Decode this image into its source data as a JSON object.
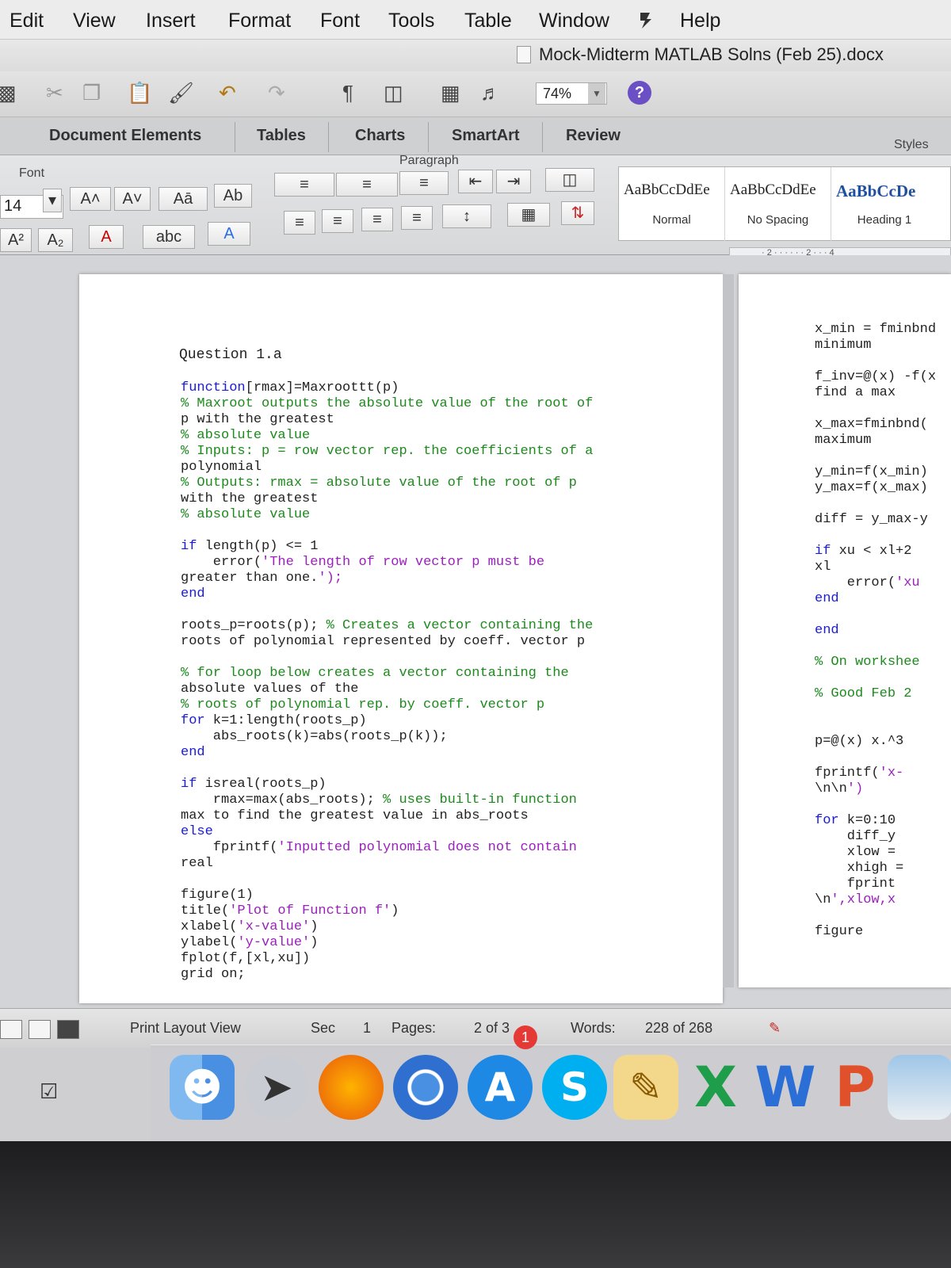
{
  "menu": [
    "Edit",
    "View",
    "Insert",
    "Format",
    "Font",
    "Tools",
    "Table",
    "Window",
    "Help"
  ],
  "title": "Mock-Midterm MATLAB Solns (Feb 25).docx",
  "toolbar": {
    "zoom": "74%",
    "help": "?"
  },
  "ribbon": {
    "tabs": [
      "Document Elements",
      "Tables",
      "Charts",
      "SmartArt",
      "Review"
    ],
    "font_group": "Font",
    "paragraph_group": "Paragraph",
    "styles_group": "Styles",
    "font_size": "14",
    "styles": [
      {
        "sample": "AaBbCcDdEe",
        "name": "Normal"
      },
      {
        "sample": "AaBbCcDdEe",
        "name": "No Spacing"
      },
      {
        "sample": "AaBbCcDe",
        "name": "Heading 1"
      }
    ],
    "ruler": "· 2 · · · · · · 2 · · · 4"
  },
  "document": {
    "question": "Question 1.a",
    "lines": [
      "function[rmax]=Maxroottt(p)",
      "% Maxroot outputs the absolute value of the root of",
      "p with the greatest",
      "% absolute value",
      "% Inputs: p = row vector rep. the coefficients of a",
      "polynomial",
      "% Outputs: rmax = absolute value of the root of p",
      "with the greatest",
      "% absolute value",
      "",
      "if length(p) <= 1",
      "    error('The length of row vector p must be",
      "greater than one.');",
      "end",
      "",
      "roots_p=roots(p); % Creates a vector containing the",
      "roots of polynomial represented by coeff. vector p",
      "",
      "% for loop below creates a vector containing the",
      "absolute values of the",
      "% roots of polynomial rep. by coeff. vector p",
      "for k=1:length(roots_p)",
      "    abs_roots(k)=abs(roots_p(k));",
      "end",
      "",
      "if isreal(roots_p)",
      "    rmax=max(abs_roots); % uses built-in function",
      "max to find the greatest value in abs_roots",
      "else",
      "    fprintf('Inputted polynomial does not contain",
      "real",
      "",
      "figure(1)",
      "title('Plot of Function f')",
      "xlabel('x-value')",
      "ylabel('y-value')",
      "fplot(f,[xl,xu])",
      "grid on;"
    ],
    "page2_lines": [
      "x_min = fminbnd",
      "minimum",
      "",
      "f_inv=@(x) -f(x",
      "find a max",
      "",
      "x_max=fminbnd(",
      "maximum",
      "",
      "y_min=f(x_min)",
      "y_max=f(x_max)",
      "",
      "diff = y_max-y",
      "",
      "if xu < xl+2",
      "xl",
      "    error('xu",
      "end",
      "",
      "end",
      "",
      "% On workshee",
      "",
      "% Good Feb 2",
      "",
      "",
      "p=@(x) x.^3",
      "",
      "fprintf('x-",
      "\\n\\n')",
      "",
      "for k=0:10",
      "    diff_y",
      "    xlow =",
      "    xhigh =",
      "    fprint",
      "\\n',xlow,x",
      "",
      "figure"
    ]
  },
  "status": {
    "view": "Print Layout View",
    "sec_label": "Sec",
    "sec_value": "1",
    "pages_label": "Pages:",
    "pages_value": "2 of 3",
    "words_label": "Words:",
    "words_value": "228 of 268"
  },
  "dock": {
    "badge": "1",
    "apps": [
      "finder-icon",
      "launchpad-icon",
      "firefox-icon",
      "chrome-icon",
      "app-store-icon",
      "skype-icon",
      "textedit-icon",
      "excel-icon",
      "word-icon",
      "powerpoint-icon",
      "preview-icon"
    ],
    "letters": {
      "skype": "S",
      "excel": "X",
      "word": "W",
      "powerpoint": "P"
    }
  }
}
